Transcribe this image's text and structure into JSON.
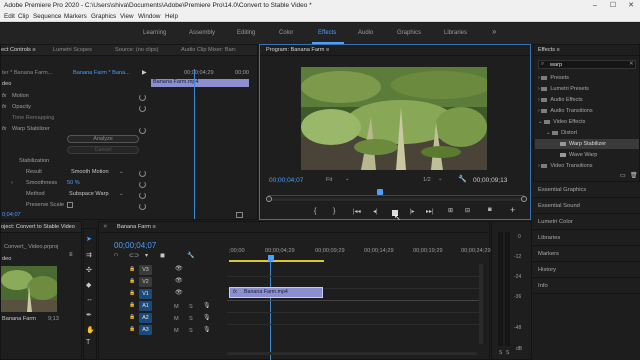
{
  "window": {
    "title": "Adobe Premiere Pro 2020 - C:\\Users\\shiva\\Documents\\Adobe\\Premiere Pro\\14.0\\Convert to Stable Video *"
  },
  "menu": [
    "Edit",
    "Clip",
    "Sequence",
    "Markers",
    "Graphics",
    "View",
    "Window",
    "Help"
  ],
  "workspaces": {
    "items": [
      "Learning",
      "Assembly",
      "Editing",
      "Color",
      "Effects",
      "Audio",
      "Graphics",
      "Libraries"
    ],
    "active": "Effects",
    "more": "»"
  },
  "effect_controls": {
    "tabs": [
      "ect Controls ≡",
      "Lumetri Scopes",
      "Source: (no clips)",
      "Audio Clip Mixer: Ban:"
    ],
    "clip_path": "ter * Banana Farm...",
    "clip_seq": "Banana Farm * Bana...",
    "ruler": [
      "00;00;04;29",
      "00;00"
    ],
    "clip_label": "Banana Farm.mp4",
    "section": "deo",
    "props": [
      "Motion",
      "Opacity",
      "Time Remapping",
      "Warp Stabilizer"
    ],
    "analyze_label": "Analyze",
    "cancel_label": "Cancel",
    "stabilization": "Stabilization",
    "result_label": "Result",
    "result_value": "Smooth Motion",
    "smoothness_label": "Smoothness",
    "smoothness_value": "50 %",
    "method_label": "Method",
    "method_value": "Subspace Warp",
    "preserve_label": "Preserve Scale",
    "timecode": "0;04;07"
  },
  "program": {
    "title": "Program: Banana Farm ≡",
    "timecode": "00;00;04;07",
    "fit": "Fit",
    "quality": "1/2",
    "duration": "00;00;09;13"
  },
  "project": {
    "tab": "oject: Convert to Stable Video",
    "file": "Convert_ Video.prproj",
    "bin": "deo",
    "thumb_name": "Banana Farm",
    "thumb_dur": "9;13"
  },
  "timeline": {
    "tab": "Banana Farm ≡",
    "timecode": "00;00;04;07",
    "ruler": [
      ";00;00",
      "00;00;04;29",
      "00;00;09;29",
      "00;00;14;29",
      "00;00;19;29",
      "00;00;24;29"
    ],
    "tracks": [
      "V3",
      "V2",
      "V1",
      "A1",
      "A2",
      "A3"
    ],
    "track_letters": {
      "m": "M",
      "s": "S"
    },
    "clip": "Banana Farm.mp4",
    "fx_badge": "fx"
  },
  "meter": {
    "labels": [
      "0",
      "-12",
      "-24",
      "-36",
      "-48",
      "dB"
    ]
  },
  "effects": {
    "title": "Effects ≡",
    "search": "warp",
    "tree": [
      "Presets",
      "Lumetri Presets",
      "Audio Effects",
      "Audio Transitions",
      "Video Effects",
      "Distort",
      "Warp Stabilizer",
      "Wave Warp",
      "Video Transitions"
    ],
    "selected": "Warp Stabilizer"
  },
  "side_panels": [
    "Essential Graphics",
    "Essential Sound",
    "Lumetri Color",
    "Libraries",
    "Markers",
    "History",
    "Info"
  ],
  "colors": {
    "accent": "#4a9fff",
    "clip_fill": "#8b8fcf",
    "playhead": "#3b8ad6"
  }
}
